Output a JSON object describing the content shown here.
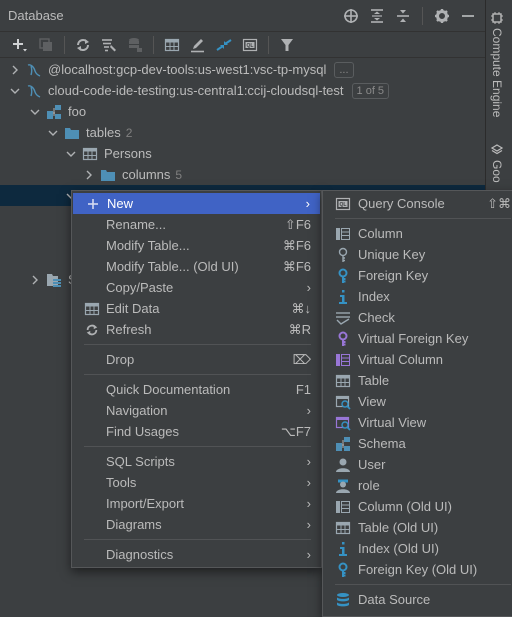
{
  "window": {
    "title": "Database"
  },
  "title_actions": [
    {
      "name": "locate-icon",
      "glyph": "crosshair"
    },
    {
      "name": "expand-all-icon",
      "glyph": "expand"
    },
    {
      "name": "collapse-all-icon",
      "glyph": "collapse"
    },
    {
      "name": "gear-icon",
      "glyph": "gear"
    },
    {
      "name": "minimize-icon",
      "glyph": "minus"
    }
  ],
  "toolbar": [
    {
      "name": "add-icon"
    },
    {
      "name": "duplicate-icon"
    },
    {
      "name": "refresh-icon"
    },
    {
      "name": "database-tools-icon"
    },
    {
      "name": "schema-disabled-icon"
    },
    {
      "name": "table-view-icon"
    },
    {
      "name": "edit-icon"
    },
    {
      "name": "jump-to-source-icon"
    },
    {
      "name": "query-console-icon"
    },
    {
      "name": "filter-icon"
    }
  ],
  "tree": {
    "nodes": [
      {
        "label": "@localhost:gcp-dev-tools:us-west1:vsc-tp-mysql",
        "badge": "...",
        "expanded": false
      },
      {
        "label": "cloud-code-ide-testing:us-central1:ccij-cloudsql-test",
        "badge": "1 of 5",
        "expanded": true
      },
      {
        "label": "foo",
        "expanded": true
      },
      {
        "label": "tables",
        "count": "2",
        "expanded": true
      },
      {
        "label": "Persons",
        "expanded": true
      },
      {
        "label": "columns",
        "count": "5",
        "expanded": false
      },
      {
        "label": "",
        "expanded": true
      },
      {
        "label": "S",
        "expanded": false
      }
    ]
  },
  "sidebar": {
    "tabs": [
      {
        "label": "Compute Engine"
      },
      {
        "label": "Goo"
      }
    ]
  },
  "context_menu": {
    "items": [
      {
        "label": "New",
        "submenu": true,
        "icon": "plus"
      },
      {
        "label": "Rename...",
        "shortcut": "⇧F6"
      },
      {
        "label": "Modify Table...",
        "shortcut": "⌘F6"
      },
      {
        "label": "Modify Table... (Old UI)",
        "shortcut": "⌘F6"
      },
      {
        "label": "Copy/Paste",
        "submenu": true
      },
      {
        "label": "Edit Data",
        "shortcut": "⌘↓",
        "icon": "table"
      },
      {
        "label": "Refresh",
        "shortcut": "⌘R",
        "icon": "refresh"
      },
      {
        "label": "Drop",
        "shortcut": "⌦"
      },
      {
        "label": "Quick Documentation",
        "shortcut": "F1"
      },
      {
        "label": "Navigation",
        "submenu": true
      },
      {
        "label": "Find Usages",
        "shortcut": "⌥F7"
      },
      {
        "label": "SQL Scripts",
        "submenu": true
      },
      {
        "label": "Tools",
        "submenu": true
      },
      {
        "label": "Import/Export",
        "submenu": true
      },
      {
        "label": "Diagrams",
        "submenu": true
      },
      {
        "label": "Diagnostics",
        "submenu": true
      }
    ],
    "arrow": "›"
  },
  "submenu": {
    "items": [
      {
        "label": "Query Console",
        "shortcut": "⇧⌘"
      },
      {
        "label": "Column"
      },
      {
        "label": "Unique Key"
      },
      {
        "label": "Foreign Key"
      },
      {
        "label": "Index"
      },
      {
        "label": "Check"
      },
      {
        "label": "Virtual Foreign Key"
      },
      {
        "label": "Virtual Column"
      },
      {
        "label": "Table"
      },
      {
        "label": "View"
      },
      {
        "label": "Virtual View"
      },
      {
        "label": "Schema"
      },
      {
        "label": "User"
      },
      {
        "label": "role"
      },
      {
        "label": "Column (Old UI)"
      },
      {
        "label": "Table (Old UI)"
      },
      {
        "label": "Index (Old UI)"
      },
      {
        "label": "Foreign Key (Old UI)"
      },
      {
        "label": "Data Source"
      }
    ]
  },
  "colors": {
    "background": "#3c3f41",
    "selection": "#0d293e",
    "menu_active": "#4063c5",
    "folder_blue": "#4e8fb5",
    "index_blue": "#3592c4",
    "virtual_purple": "#9876d6",
    "text": "#bbbbbb"
  }
}
